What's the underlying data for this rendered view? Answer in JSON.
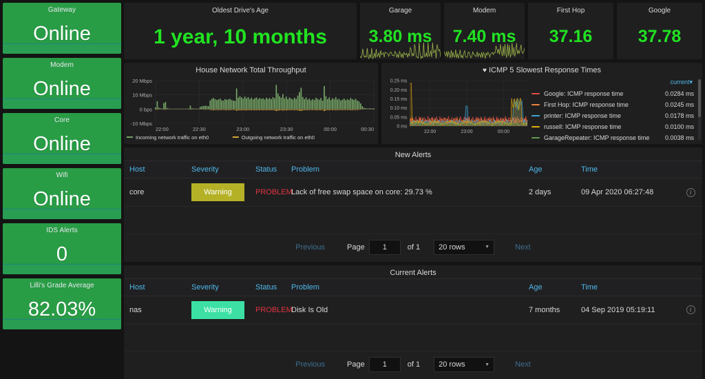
{
  "sidebar": {
    "panels": [
      {
        "title": "Gateway",
        "value": "Online",
        "bg": "#299c46",
        "has_spark": true
      },
      {
        "title": "Modem",
        "value": "Online",
        "bg": "#299c46",
        "has_spark": true
      },
      {
        "title": "Core",
        "value": "Online",
        "bg": "#299c46",
        "has_spark": true
      },
      {
        "title": "Wifi",
        "value": "Online",
        "bg": "#299c46",
        "has_spark": true
      },
      {
        "title": "IDS Alerts",
        "value": "0",
        "bg": "#299c46",
        "has_spark": true
      },
      {
        "title": "Lilli's Grade Average",
        "value": "82.03%",
        "bg": "#299c46",
        "has_spark": true
      }
    ]
  },
  "top_stats": [
    {
      "title": "Oldest Drive's Age",
      "value": "1 year, 10 months",
      "color": "#21e321",
      "font_size": "30px",
      "has_spark": false
    },
    {
      "title": "Garage",
      "value": "3.80 ms",
      "color": "#21e321",
      "font_size": "25px",
      "has_spark": true
    },
    {
      "title": "Modem",
      "value": "7.40 ms",
      "color": "#21e321",
      "font_size": "25px",
      "has_spark": true
    },
    {
      "title": "First Hop",
      "value": "37.16",
      "color": "#21e321",
      "font_size": "25px",
      "has_spark": false
    },
    {
      "title": "Google",
      "value": "37.78",
      "color": "#21e321",
      "font_size": "25px",
      "has_spark": false
    }
  ],
  "throughput": {
    "title": "House Network Total Throughput",
    "legend": [
      {
        "label": "Incoming network traffic on eth0",
        "color": "#7eb26d"
      },
      {
        "label": "Outgoing network traffic on eth0",
        "color": "#eab839"
      }
    ]
  },
  "icmp": {
    "title": "ICMP 5 Slowest Response Times",
    "favorite_icon": "heart-icon",
    "legend_header": "current",
    "series": [
      {
        "label": "Google: ICMP response time",
        "value": "0.0284 ms",
        "color": "#e24d42"
      },
      {
        "label": "First Hop: ICMP response time",
        "value": "0.0245 ms",
        "color": "#ef843c"
      },
      {
        "label": "printer: ICMP response time",
        "value": "0.0178 ms",
        "color": "#3aa8d8"
      },
      {
        "label": "russell: ICMP response time",
        "value": "0.0100 ms",
        "color": "#e5ac0e"
      },
      {
        "label": "GarageRepeater: ICMP response time",
        "value": "0.0038 ms",
        "color": "#629e51"
      }
    ]
  },
  "chart_data": [
    {
      "type": "area",
      "title": "House Network Total Throughput",
      "xlabel": "",
      "ylabel": "",
      "ylim": [
        -10,
        20
      ],
      "ytick_labels": [
        "20 Mbps",
        "10 Mbps",
        "0 bps",
        "-10 Mbps"
      ],
      "ytick_values": [
        20,
        10,
        0,
        -10
      ],
      "xtick_labels": [
        "22:00",
        "22:30",
        "23:00",
        "23:30",
        "00:00",
        "00:30"
      ],
      "grid": true,
      "legend_position": "bottom",
      "series": [
        {
          "name": "Incoming network traffic on eth0",
          "color": "#7eb26d",
          "values": [
            1.2,
            5.5,
            1.0,
            0.6,
            0.5,
            4.2,
            5.0,
            0.8,
            0.4,
            0.3,
            0.3,
            0.3,
            0.3,
            0.3,
            0.4,
            0.3,
            0.3,
            0.3,
            0.3,
            0.4,
            0.3,
            2.5,
            0.6,
            0.4,
            0.4,
            0.4,
            0.4,
            1.5,
            2.0,
            2.2,
            2.4,
            2.2,
            2.0,
            6.0,
            7.2,
            7.8,
            7.0,
            6.4,
            6.8,
            7.4,
            6.2,
            6.0,
            7.0,
            6.6,
            6.8,
            7.2,
            6.4,
            6.0,
            5.8,
            14.5,
            8.0,
            9.0,
            8.2,
            7.4,
            8.8,
            7.6,
            8.4,
            7.0,
            8.0,
            6.8,
            7.6,
            8.2,
            7.0,
            7.8,
            7.2,
            7.6,
            6.8,
            8.0,
            7.2,
            7.8,
            7.0,
            8.4,
            7.6,
            17.0,
            11.0,
            9.0,
            8.0,
            10.5,
            7.5,
            8.8,
            7.0,
            8.2,
            7.4,
            6.8,
            8.0,
            7.2,
            9.5,
            12.0,
            15.0,
            8.5,
            7.0,
            8.2,
            6.6,
            7.4,
            6.2,
            7.0,
            6.4,
            8.0,
            7.2,
            6.6,
            7.8,
            6.0,
            16.2,
            9.0,
            7.0,
            8.2,
            6.4,
            7.6,
            7.0,
            8.4,
            6.8,
            7.2,
            6.0,
            6.6,
            7.4,
            6.2,
            7.0,
            6.4,
            7.8,
            7.0,
            6.4,
            7.2,
            6.0,
            5.4,
            4.0,
            2.0,
            1.0,
            0.6,
            0.5,
            0.5,
            0.6,
            0.5,
            0.5
          ]
        },
        {
          "name": "Outgoing network traffic on eth0",
          "color": "#eab839",
          "values": [
            -0.3,
            -0.5,
            -0.3,
            -0.2,
            -0.2,
            -0.4,
            -0.5,
            -0.2,
            -0.2,
            -0.2,
            -0.2,
            -0.2,
            -0.2,
            -0.2,
            -0.2,
            -0.2,
            -0.2,
            -0.2,
            -0.2,
            -0.2,
            -0.2,
            -0.4,
            -0.2,
            -0.2,
            -0.2,
            -0.2,
            -0.2,
            -0.3,
            -0.3,
            -0.4,
            -0.4,
            -0.4,
            -0.3,
            -0.6,
            -0.7,
            -0.8,
            -0.7,
            -0.6,
            -0.7,
            -0.7,
            -0.6,
            -0.6,
            -0.7,
            -0.7,
            -0.7,
            -0.7,
            -0.6,
            -0.6,
            -0.6,
            -1.2,
            -0.8,
            -0.9,
            -0.8,
            -0.7,
            -0.9,
            -0.8,
            -0.8,
            -0.7,
            -0.8,
            -0.7,
            -0.8,
            -0.8,
            -0.7,
            -0.8,
            -0.7,
            -0.8,
            -0.7,
            -0.8,
            -0.7,
            -0.8,
            -0.7,
            -0.8,
            -0.8,
            -1.4,
            -1.0,
            -0.9,
            -0.8,
            -1.0,
            -0.8,
            -0.9,
            -0.7,
            -0.8,
            -0.7,
            -0.7,
            -0.8,
            -0.7,
            -0.9,
            -1.1,
            -1.3,
            -0.9,
            -0.7,
            -0.8,
            -0.7,
            -0.7,
            -0.6,
            -0.7,
            -0.6,
            -0.8,
            -0.7,
            -0.7,
            -0.8,
            -0.6,
            -1.4,
            -0.9,
            -0.7,
            -0.8,
            -0.6,
            -0.8,
            -0.7,
            -0.8,
            -0.7,
            -0.7,
            -0.6,
            -0.7,
            -0.7,
            -0.6,
            -0.7,
            -0.6,
            -0.8,
            -0.7,
            -0.6,
            -0.7,
            -0.6,
            -0.5,
            -0.4,
            -0.3,
            -0.2,
            -0.2,
            -0.2,
            -0.2,
            -0.2,
            -0.2,
            -0.2
          ]
        }
      ]
    },
    {
      "type": "line",
      "title": "ICMP 5 Slowest Response Times",
      "xlabel": "",
      "ylabel": "",
      "ylim": [
        0,
        0.25
      ],
      "ytick_labels": [
        "0.25 ms",
        "0.20 ms",
        "0.15 ms",
        "0.10 ms",
        "0.05 ms",
        "0 ms"
      ],
      "ytick_values": [
        0.25,
        0.2,
        0.15,
        0.1,
        0.05,
        0
      ],
      "xtick_labels": [
        "22:00",
        "23:00",
        "00:00"
      ],
      "grid": true,
      "legend_position": "right",
      "series": [
        {
          "name": "Google: ICMP response time",
          "color": "#e24d42",
          "current": 0.0284
        },
        {
          "name": "First Hop: ICMP response time",
          "color": "#ef843c",
          "current": 0.0245
        },
        {
          "name": "printer: ICMP response time",
          "color": "#3aa8d8",
          "current": 0.0178
        },
        {
          "name": "russell: ICMP response time",
          "color": "#e5ac0e",
          "current": 0.01
        },
        {
          "name": "GarageRepeater: ICMP response time",
          "color": "#629e51",
          "current": 0.0038
        }
      ]
    }
  ],
  "new_alerts": {
    "title": "New Alerts",
    "columns": [
      "Host",
      "Severity",
      "Status",
      "Problem",
      "Age",
      "Time"
    ],
    "rows": [
      {
        "host": "core",
        "severity": "Warning",
        "severity_color": "#b5b127",
        "status": "PROBLEM",
        "problem": "Lack of free swap space on core: 29.73 %",
        "age": "2 days",
        "time": "09 Apr 2020 06:27:48",
        "info_icon": "info-circle-icon"
      }
    ],
    "pager": {
      "previous": "Previous",
      "page_label": "Page",
      "page_value": "1",
      "of_label": "of 1",
      "rows_per_page": "20 rows",
      "next": "Next"
    }
  },
  "current_alerts": {
    "title": "Current Alerts",
    "columns": [
      "Host",
      "Severity",
      "Status",
      "Problem",
      "Age",
      "Time"
    ],
    "rows": [
      {
        "host": "nas",
        "severity": "Warning",
        "severity_color": "#3ce0a5",
        "status": "PROBLEM",
        "problem": "Disk Is Old",
        "age": "7 months",
        "time": "04 Sep 2019 05:19:11",
        "info_icon": "info-circle-icon"
      }
    ],
    "pager": {
      "previous": "Previous",
      "page_label": "Page",
      "page_value": "1",
      "of_label": "of 1",
      "rows_per_page": "20 rows",
      "next": "Next"
    }
  }
}
